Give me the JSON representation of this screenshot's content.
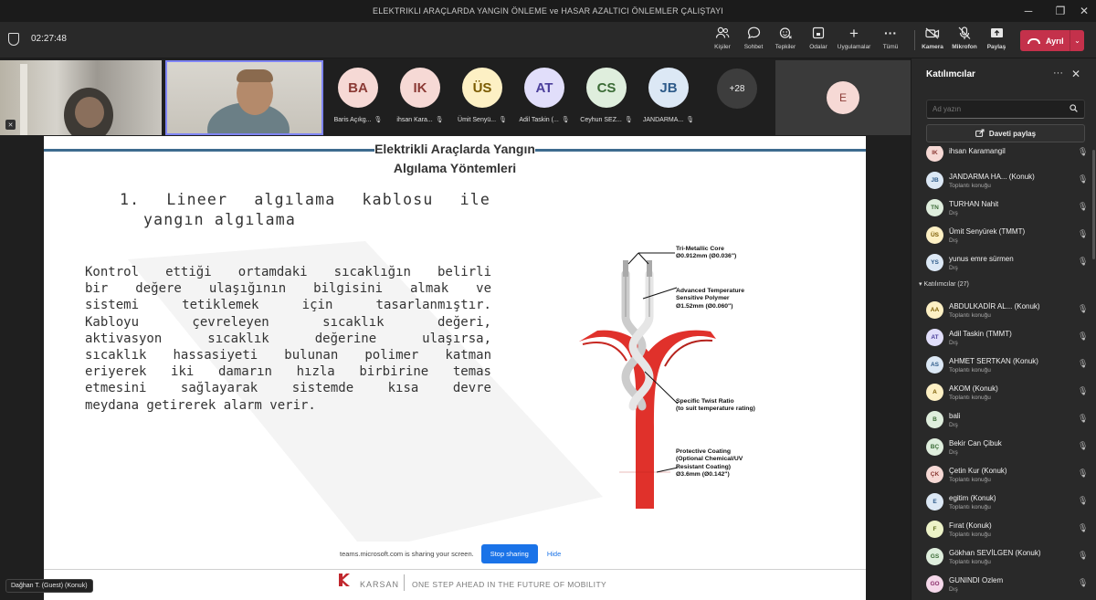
{
  "window": {
    "title": "ELEKTRIKLI ARAÇLARDA YANGIN ÖNLEME ve HASAR AZALTICI ÖNLEMLER ÇALIŞTAYI"
  },
  "toolbar": {
    "timer": "02:27:48",
    "buttons": {
      "people": "Kişiler",
      "chat": "Sohbet",
      "react": "Tepkiler",
      "rooms": "Odalar",
      "apps": "Uygulamalar",
      "more": "Tümü",
      "camera": "Kamera",
      "mic": "Mikrofon",
      "share": "Paylaş"
    },
    "leave": "Ayrıl"
  },
  "strip": {
    "tiles": [
      {
        "initials": "BA",
        "name": "Baris Açıkg...",
        "bg": "#f6d9d5",
        "fg": "#8b3a35"
      },
      {
        "initials": "IK",
        "name": "ihsan Kara...",
        "bg": "#f6d9d5",
        "fg": "#8b3a35"
      },
      {
        "initials": "ÜS",
        "name": "Ümit Senyü...",
        "bg": "#fdf0c4",
        "fg": "#7a5a00"
      },
      {
        "initials": "AT",
        "name": "Adil Taskin (...",
        "bg": "#e1defa",
        "fg": "#4b3f9b"
      },
      {
        "initials": "CS",
        "name": "Ceyhun SEZ...",
        "bg": "#dfeedd",
        "fg": "#3b6b36"
      },
      {
        "initials": "JB",
        "name": "JANDARMA...",
        "bg": "#dce8f5",
        "fg": "#2e5b8a"
      }
    ],
    "overflow": "+28",
    "last_initial": "E"
  },
  "slide": {
    "header_line1": "Elektrikli Araçlarda Yangın",
    "header_line2": "Algılama Yöntemleri",
    "subtitle_a": "1. Lineer algılama kablosu ile",
    "subtitle_b": "yangın algılama",
    "paragraph_lines": [
      "Kontrol ettiği ortamdaki sıcaklığın belirli",
      "bir değere ulaşığının bilgisini almak ve",
      "sistemi tetiklemek için tasarlanmıştır.",
      "Kabloyu çevreleyen sıcaklık değeri,",
      "aktivasyon sıcaklık değerine ulaşırsa,",
      "sıcaklık hassasiyeti bulunan polimer katman",
      "eriyerek iki damarın hızla birbirine temas",
      "etmesini sağlayarak sistemde kısa devre",
      "meydana getirerek alarm verir."
    ],
    "callouts": [
      {
        "lines": [
          "Tri-Metallic Core",
          "Ø0.912mm (Ø0.036\")"
        ]
      },
      {
        "lines": [
          "Advanced Temperature",
          "Sensitive Polymer",
          "Ø1.52mm (Ø0.060\")"
        ]
      },
      {
        "lines": [
          "Specific Twist Ratio",
          "(to suit temperature rating)"
        ]
      },
      {
        "lines": [
          "Protective Coating",
          "(Optional Chemical/UV",
          "Resistant Coating)",
          "Ø3.6mm (Ø0.142\")"
        ]
      }
    ],
    "footer_brand": "KARSAN",
    "footer_tagline": "ONE STEP AHEAD IN THE FUTURE OF MOBILITY",
    "cable_color": "#e0312b",
    "accent": "#3e6b8f"
  },
  "share_notice": {
    "text": "teams.microsoft.com is sharing your screen.",
    "stop": "Stop sharing",
    "hide": "Hide"
  },
  "presenter_tag": "Dağhan T. (Guest) (Konuk)",
  "panel": {
    "title": "Katılımcılar",
    "search_placeholder": "Ad yazın",
    "invite": "Daveti paylaş",
    "section_attendees": "Katılımcılar (27)",
    "top_people": [
      {
        "initials": "IK",
        "name": "ihsan Karamangil",
        "status": "",
        "bg": "#f6d9d5",
        "fg": "#8b3a35"
      },
      {
        "initials": "JB",
        "name": "JANDARMA HA...   (Konuk)",
        "status": "Toplantı konuğu",
        "bg": "#dce8f5",
        "fg": "#2e5b8a"
      },
      {
        "initials": "TN",
        "name": "TURHAN Nahit",
        "status": "Dış",
        "bg": "#dfeedd",
        "fg": "#3b6b36"
      },
      {
        "initials": "ÜS",
        "name": "Ümit Senyürek (TMMT)",
        "status": "Dış",
        "bg": "#fdf0c4",
        "fg": "#7a5a00"
      },
      {
        "initials": "YS",
        "name": "yunus emre sürmen",
        "status": "Dış",
        "bg": "#dce8f5",
        "fg": "#2e5b8a"
      }
    ],
    "attendees": [
      {
        "initials": "AA",
        "name": "ABDULKADİR AL...  (Konuk)",
        "status": "Toplantı konuğu",
        "bg": "#fdf0c4",
        "fg": "#7a5a00"
      },
      {
        "initials": "AT",
        "name": "Adil Taskin (TMMT)",
        "status": "Dış",
        "bg": "#e1defa",
        "fg": "#4b3f9b"
      },
      {
        "initials": "AS",
        "name": "AHMET SERTKAN (Konuk)",
        "status": "Toplantı konuğu",
        "bg": "#dce8f5",
        "fg": "#2e5b8a"
      },
      {
        "initials": "A",
        "name": "AKOM (Konuk)",
        "status": "Toplantı konuğu",
        "bg": "#fdf0c4",
        "fg": "#7a5a00"
      },
      {
        "initials": "B",
        "name": "bali",
        "status": "Dış",
        "bg": "#dfeedd",
        "fg": "#3b6b36"
      },
      {
        "initials": "BÇ",
        "name": "Bekir Can Çibuk",
        "status": "Dış",
        "bg": "#dfeedd",
        "fg": "#3b6b36"
      },
      {
        "initials": "ÇK",
        "name": "Çetin Kur (Konuk)",
        "status": "Toplantı konuğu",
        "bg": "#f6d9d5",
        "fg": "#8b3a35"
      },
      {
        "initials": "E",
        "name": "egitim (Konuk)",
        "status": "Toplantı konuğu",
        "bg": "#dce8f5",
        "fg": "#2e5b8a"
      },
      {
        "initials": "F",
        "name": "Fırat (Konuk)",
        "status": "Toplantı konuğu",
        "bg": "#edf3c8",
        "fg": "#5b6b1a"
      },
      {
        "initials": "GS",
        "name": "Gökhan SEVİLGEN (Konuk)",
        "status": "Toplantı konuğu",
        "bg": "#dfeedd",
        "fg": "#3b6b36"
      },
      {
        "initials": "GO",
        "name": "GUNINDI Ozlem",
        "status": "Dış",
        "bg": "#f5d8ea",
        "fg": "#8a2f6b"
      }
    ]
  }
}
